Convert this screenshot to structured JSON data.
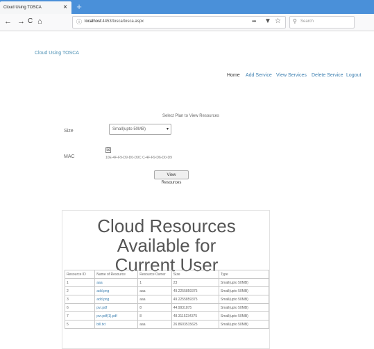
{
  "browser": {
    "tab_title": "Cloud Using TOSCA",
    "tab_close": "×",
    "new_tab": "+",
    "back": "←",
    "forward": "→",
    "reload": "C",
    "home": "⌂",
    "url_host": "localhost",
    "url_path": ":4453/tosca/tosca.aspx",
    "url_more": "•••",
    "search_placeholder": "Search"
  },
  "site": {
    "brand": "Cloud Using TOSCA",
    "menu": [
      "Home",
      "Add Service",
      "View Services",
      "Delete Service",
      "Logout"
    ]
  },
  "form": {
    "heading": "Select Plan to View Resources",
    "size_label": "Size",
    "size_value": "Small(upto 50MB)",
    "mac_label": "MAC",
    "checkbox_mark": "☒",
    "mac_value": "10E-4F-F9-D9-D0-D9C C-4F-F9-D6-D0-D9",
    "view_button": "View Resources"
  },
  "resources": {
    "title_line1": "Cloud Resources Available for",
    "title_line2": "Current User",
    "columns": [
      "Resource ID",
      "Name of Resource",
      "Resource Owner",
      "Size",
      "Type"
    ],
    "rows": [
      [
        "1",
        "aaa",
        "1",
        "23",
        "Small(upto 50MB)"
      ],
      [
        "2",
        "add.png",
        "aaa",
        "49.2255859375",
        "Small(upto 50MB)"
      ],
      [
        "3",
        "add.png",
        "aaa",
        "49.2255859375",
        "Small(upto 50MB)"
      ],
      [
        "6",
        "pvr.pdf",
        "8",
        "44.9931875",
        "Small(upto 50MB)"
      ],
      [
        "7",
        "pvr.pdf(1).pdf",
        "8",
        "48.3115234375",
        "Small(upto 50MB)"
      ],
      [
        "5",
        "bill.txt",
        "aaa",
        "26.8603515625",
        "Small(upto 50MB)"
      ]
    ]
  }
}
